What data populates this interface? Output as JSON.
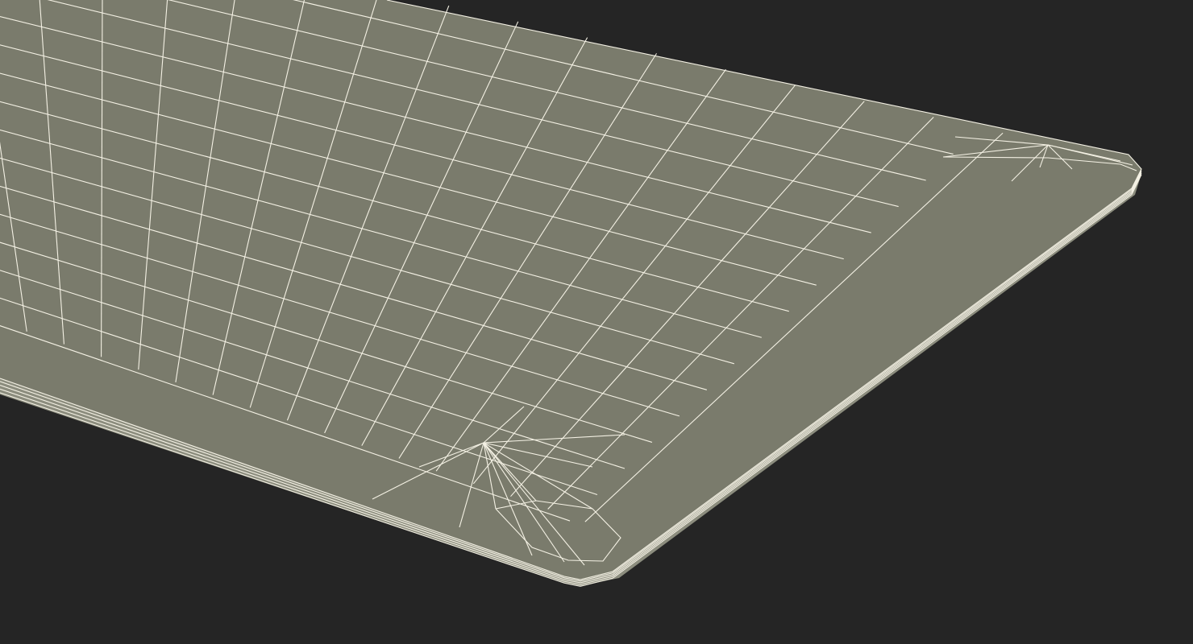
{
  "scene": {
    "background_color": "#252525",
    "surface_color": "#7a7b6c",
    "edge_band_color": "#8c8d7e",
    "wire_color": "#f4f1e4",
    "subject": "wireframe-mesh-panel",
    "shading": "flat-wireframe"
  }
}
